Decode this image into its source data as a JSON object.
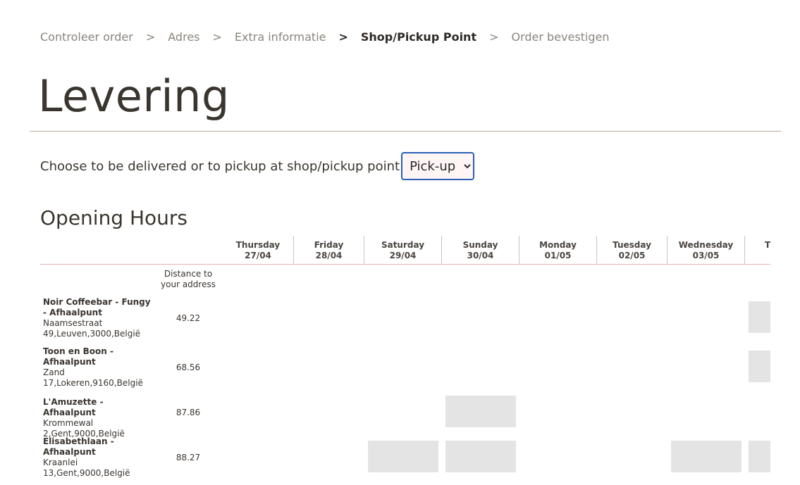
{
  "breadcrumb": {
    "steps": [
      "Controleer order",
      "Adres",
      "Extra informatie",
      "Shop/Pickup Point",
      "Order bevestigen"
    ],
    "separator": ">"
  },
  "page": {
    "title": "Levering"
  },
  "delivery_choice": {
    "label": "Choose to be delivered or to pickup at shop/pickup point",
    "selected": "Pick-up",
    "options": [
      "Pick-up"
    ]
  },
  "opening_hours": {
    "title": "Opening Hours",
    "distance_header": "Distance to your address",
    "days": [
      {
        "name": "Thursday",
        "date": "27/04"
      },
      {
        "name": "Friday",
        "date": "28/04"
      },
      {
        "name": "Saturday",
        "date": "29/04"
      },
      {
        "name": "Sunday",
        "date": "30/04"
      },
      {
        "name": "Monday",
        "date": "01/05"
      },
      {
        "name": "Tuesday",
        "date": "02/05"
      },
      {
        "name": "Wednesday",
        "date": "03/05"
      },
      {
        "name": "Th",
        "date": ""
      }
    ],
    "shops": [
      {
        "name": "Noir Coffeebar - Fungy - Afhaalpunt",
        "address": "Naamsestraat 49,Leuven,3000,België",
        "distance": "49.22"
      },
      {
        "name": "Toon en Boon - Afhaalpunt",
        "address": "Zand 17,Lokeren,9160,België",
        "distance": "68.56"
      },
      {
        "name": "L'Amuzette - Afhaalpunt",
        "address": "Krommewal 2,Gent,9000,België",
        "distance": "87.86"
      },
      {
        "name": "Elisabethlaan - Afhaalpunt",
        "address": "Kraanlei 13,Gent,9000,België",
        "distance": "88.27"
      }
    ]
  }
}
